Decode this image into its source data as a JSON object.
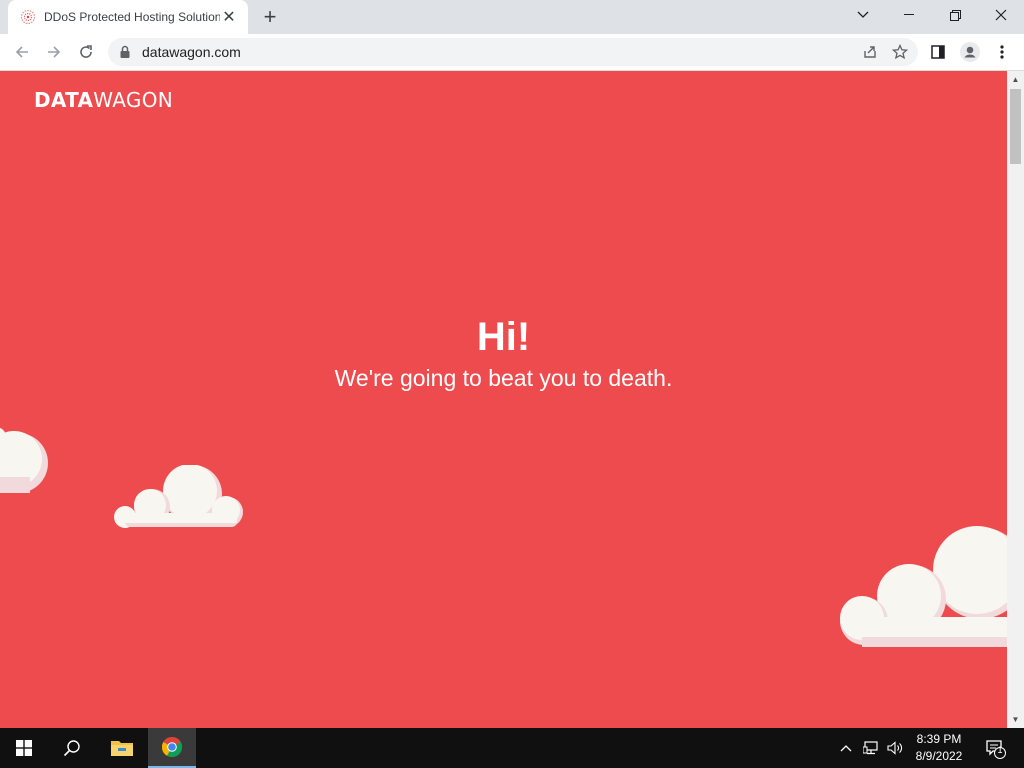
{
  "browser": {
    "tab_title": "DDoS Protected Hosting Solutions",
    "tab_close": "✕",
    "new_tab": "+",
    "url": "datawagon.com",
    "window_controls": {
      "dropdown": "⌄",
      "minimize": "—",
      "restore": "❐",
      "close": "✕"
    }
  },
  "page": {
    "logo_bold": "DATA",
    "logo_light": "WAGON",
    "hero_title": "Hi!",
    "hero_subtitle": "We're going to beat you to death.",
    "background_color": "#ee4b4e",
    "cloud_color": "#f8f6f0",
    "cloud_shadow_color": "#f1d9dc"
  },
  "scrollbar": {
    "up_arrow": "▲",
    "down_arrow": "▼"
  },
  "taskbar": {
    "time": "8:39 PM",
    "date": "8/9/2022",
    "notification_count": "1",
    "icons": [
      "windows-start-icon",
      "search-icon",
      "file-explorer-icon",
      "chrome-icon",
      "chevron-up-icon",
      "network-icon",
      "volume-icon",
      "notification-icon"
    ]
  }
}
